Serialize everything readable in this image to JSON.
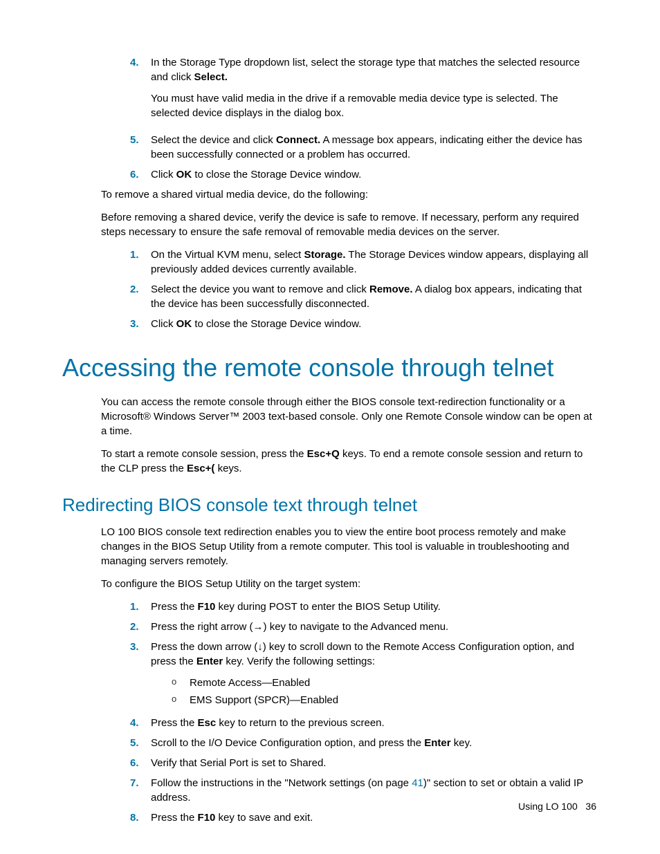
{
  "top_list": {
    "i4": {
      "num": "4.",
      "p1_a": "In the Storage Type dropdown list, select the storage type that matches the selected resource and click ",
      "p1_b": "Select.",
      "p2": "You must have valid media in the drive if a removable media device type is selected. The selected device displays in the dialog box."
    },
    "i5": {
      "num": "5.",
      "a": "Select the device and click ",
      "b": "Connect.",
      "c": " A message box appears, indicating either the device has been successfully connected or a problem has occurred."
    },
    "i6": {
      "num": "6.",
      "a": "Click ",
      "b": "OK",
      "c": " to close the Storage Device window."
    }
  },
  "para1": "To remove a shared virtual media device, do the following:",
  "para2": "Before removing a shared device, verify the device is safe to remove. If necessary, perform any required steps necessary to ensure the safe removal of removable media devices on the server.",
  "mid_list": {
    "i1": {
      "num": "1.",
      "a": "On the Virtual KVM menu, select ",
      "b": "Storage.",
      "c": " The Storage Devices window appears, displaying all previously added devices currently available."
    },
    "i2": {
      "num": "2.",
      "a": "Select the device you want to remove and click ",
      "b": "Remove.",
      "c": " A dialog box appears, indicating that the device has been successfully disconnected."
    },
    "i3": {
      "num": "3.",
      "a": "Click ",
      "b": "OK",
      "c": " to close the Storage Device window."
    }
  },
  "h1": "Accessing the remote console through telnet",
  "s1p1": "You can access the remote console through either the BIOS console text-redirection functionality or a Microsoft® Windows Server™ 2003 text-based console. Only one Remote Console window can be open at a time.",
  "s1p2a": "To start a remote console session, press the ",
  "s1p2b": "Esc+Q",
  "s1p2c": " keys. To end a remote console session and return to the CLP press the ",
  "s1p2d": "Esc+(",
  "s1p2e": " keys.",
  "h2": "Redirecting BIOS console text through telnet",
  "s2p1": "LO 100 BIOS console text redirection enables you to view the entire boot process remotely and make changes in the BIOS Setup Utility from a remote computer. This tool is valuable in troubleshooting and managing servers remotely.",
  "s2p2": "To configure the BIOS Setup Utility on the target system:",
  "bios_list": {
    "i1": {
      "num": "1.",
      "a": "Press the ",
      "b": "F10",
      "c": " key during POST to enter the BIOS Setup Utility."
    },
    "i2": {
      "num": "2.",
      "t": "Press the right arrow (→) key to navigate to the Advanced menu."
    },
    "i3": {
      "num": "3.",
      "a": "Press the down arrow (↓) key to scroll down to the Remote Access Configuration option, and press the ",
      "b": "Enter",
      "c": " key. Verify the following settings:",
      "s1": "Remote Access—Enabled",
      "s2": "EMS Support (SPCR)—Enabled"
    },
    "i4": {
      "num": "4.",
      "a": "Press the ",
      "b": "Esc",
      "c": " key to return to the previous screen."
    },
    "i5": {
      "num": "5.",
      "a": "Scroll to the I/O Device Configuration option, and press the ",
      "b": "Enter",
      "c": " key."
    },
    "i6": {
      "num": "6.",
      "t": "Verify that Serial Port is set to Shared."
    },
    "i7": {
      "num": "7.",
      "a": "Follow the instructions in the \"Network settings (on page ",
      "link": "41",
      "c": ")\" section to set or obtain a valid IP address."
    },
    "i8": {
      "num": "8.",
      "a": "Press the ",
      "b": "F10",
      "c": " key to save and exit."
    }
  },
  "footer": {
    "label": "Using LO 100",
    "page": "36"
  },
  "bullet": "o"
}
